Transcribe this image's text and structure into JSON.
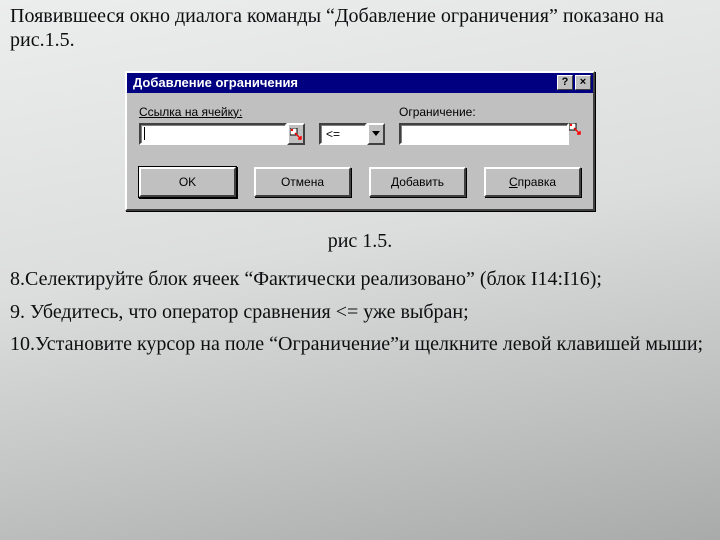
{
  "intro": "Появившееся окно диалога команды “Добавление ограничения” показано на рис.1.5.",
  "dialog": {
    "title": "Добавление ограничения",
    "help_btn": "?",
    "close_btn": "×",
    "label_cellref": "Ссылка на ячейку:",
    "label_constraint": "Ограничение:",
    "cellref_value": "",
    "operator_value": "<=",
    "constraint_value": "",
    "btn_ok": "OK",
    "btn_cancel": "Отмена",
    "btn_add_prefix": "Д",
    "btn_add_rest": "обавить",
    "btn_help_prefix": "С",
    "btn_help_rest": "правка"
  },
  "caption": "рис 1.5.",
  "step8": "8.Селектируйте блок ячеек “Фактически реализовано” (блок I14:I16);",
  "step9": "9. Убедитесь, что оператор сравнения <= уже выбран;",
  "step10": "10.Установите курсор на поле “Ограничение”и щелкните левой клавишей мыши;"
}
